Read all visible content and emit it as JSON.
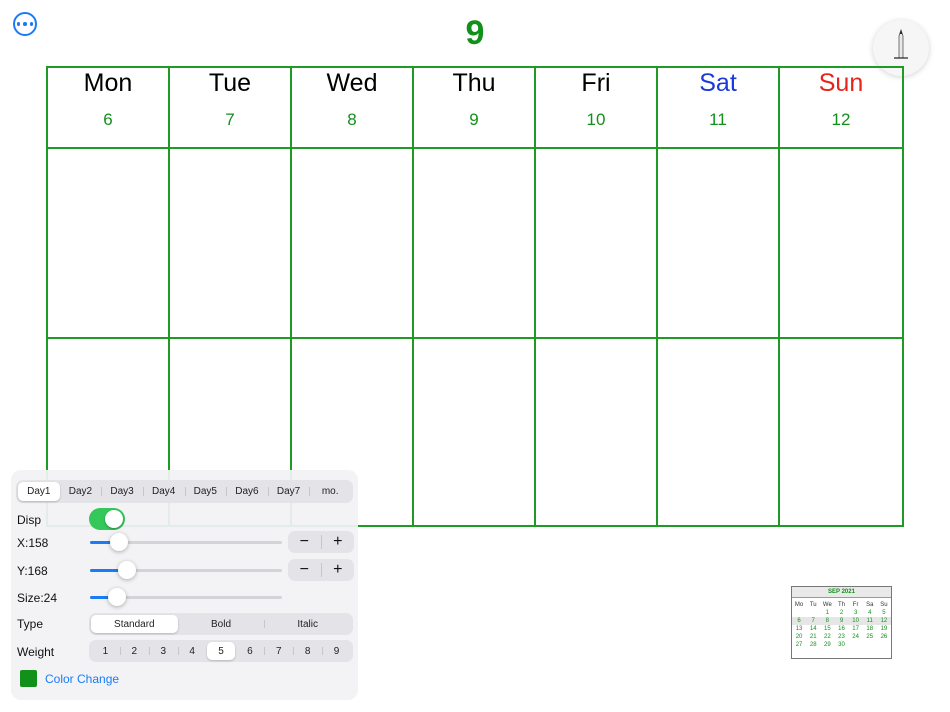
{
  "header": {
    "more_icon": "ellipsis-circle-icon",
    "month_number": "9",
    "pencil_icon": "pencil-icon"
  },
  "colors": {
    "accent_green": "#11901a",
    "grid_green": "#1f9a25",
    "saturday_blue": "#1a3ad9",
    "sunday_red": "#e8231a",
    "system_blue": "#1a7cf5"
  },
  "week": {
    "days": [
      {
        "name": "Mon",
        "date": "6"
      },
      {
        "name": "Tue",
        "date": "7"
      },
      {
        "name": "Wed",
        "date": "8"
      },
      {
        "name": "Thu",
        "date": "9"
      },
      {
        "name": "Fri",
        "date": "10"
      },
      {
        "name": "Sat",
        "date": "11"
      },
      {
        "name": "Sun",
        "date": "12"
      }
    ]
  },
  "panel": {
    "day_tabs": [
      "Day1",
      "Day2",
      "Day3",
      "Day4",
      "Day5",
      "Day6",
      "Day7",
      "mo."
    ],
    "selected_day_tab": "Day1",
    "disp_label": "Disp",
    "disp_on": true,
    "x_label": "X:158",
    "x_value": 158,
    "y_label": "Y:168",
    "y_value": 168,
    "size_label": "Size:24",
    "size_value": 24,
    "minus_symbol": "−",
    "plus_symbol": "+",
    "type_label": "Type",
    "type_options": [
      "Standard",
      "Bold",
      "Italic"
    ],
    "selected_type": "Standard",
    "weight_label": "Weight",
    "weight_options": [
      "1",
      "2",
      "3",
      "4",
      "5",
      "6",
      "7",
      "8",
      "9"
    ],
    "selected_weight": "5",
    "color_change_label": "Color Change"
  },
  "mini_calendar": {
    "title": "SEP 2021",
    "dow": [
      "Mo",
      "Tu",
      "We",
      "Th",
      "Fr",
      "Sa",
      "Su"
    ],
    "weeks": [
      [
        "",
        "",
        "1",
        "2",
        "3",
        "4",
        "5"
      ],
      [
        "6",
        "7",
        "8",
        "9",
        "10",
        "11",
        "12"
      ],
      [
        "13",
        "14",
        "15",
        "16",
        "17",
        "18",
        "19"
      ],
      [
        "20",
        "21",
        "22",
        "23",
        "24",
        "25",
        "26"
      ],
      [
        "27",
        "28",
        "29",
        "30",
        "",
        "",
        ""
      ]
    ],
    "highlighted_week": 1
  }
}
